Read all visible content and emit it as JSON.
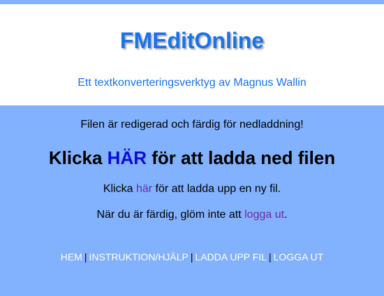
{
  "header": {
    "title": "FMEditOnline",
    "subtitle": "Ett textkonverteringsverktyg av Magnus Wallin"
  },
  "main": {
    "status": "Filen är redigerad och färdig för nedladdning!",
    "download_prefix": "Klicka ",
    "download_link": "HÄR",
    "download_suffix": " för att ladda ned filen",
    "upload_prefix": "Klicka ",
    "upload_link": "här",
    "upload_suffix": " för att ladda upp en ny fil.",
    "logout_prefix": "När du är färdig, glöm inte att ",
    "logout_link": "logga ut",
    "logout_suffix": "."
  },
  "footer_nav": {
    "items": [
      "HEM",
      "INSTRUKTION/HJÄLP",
      "LADDA UPP FIL",
      "LOGGA UT"
    ],
    "separator": "|"
  },
  "colors": {
    "page_background": "#82b1fd",
    "title_blue": "#1a73e8",
    "download_link": "#0d0dd6",
    "text_link": "#6a2ca8",
    "nav_link": "#ffffff"
  }
}
